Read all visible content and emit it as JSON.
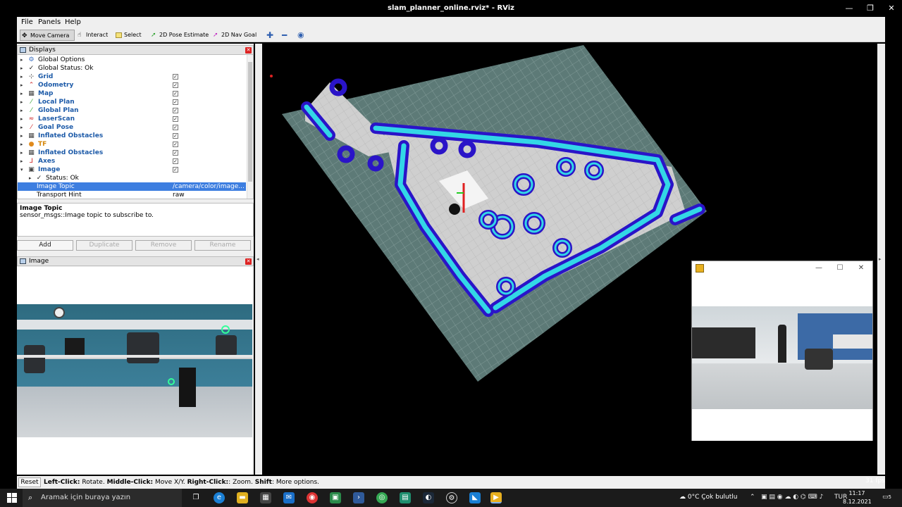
{
  "window": {
    "title": "slam_planner_online.rviz* - RViz"
  },
  "menu": {
    "file": "File",
    "panels": "Panels",
    "help": "Help"
  },
  "toolbar": {
    "move_camera": "Move Camera",
    "interact": "Interact",
    "select": "Select",
    "pose_estimate": "2D Pose Estimate",
    "nav_goal": "2D Nav Goal"
  },
  "displays_panel": {
    "title": "Displays",
    "items": [
      {
        "label": "Global Options",
        "type": "opt"
      },
      {
        "label": "Global Status: Ok",
        "type": "opt"
      },
      {
        "label": "Grid",
        "type": "disp",
        "checked": true
      },
      {
        "label": "Odometry",
        "type": "disp",
        "checked": true
      },
      {
        "label": "Map",
        "type": "disp",
        "checked": true
      },
      {
        "label": "Local Plan",
        "type": "disp",
        "checked": true
      },
      {
        "label": "Global Plan",
        "type": "disp",
        "checked": true
      },
      {
        "label": "LaserScan",
        "type": "disp",
        "checked": true
      },
      {
        "label": "Goal Pose",
        "type": "disp",
        "checked": true
      },
      {
        "label": "Inflated Obstacles",
        "type": "disp",
        "checked": true
      },
      {
        "label": "TF",
        "type": "disp",
        "checked": true
      },
      {
        "label": "Inflated Obstacles",
        "type": "disp",
        "checked": true
      },
      {
        "label": "Axes",
        "type": "disp",
        "checked": true
      },
      {
        "label": "Image",
        "type": "disp",
        "checked": true
      },
      {
        "label": "Status: Ok",
        "type": "sub"
      },
      {
        "label": "Image Topic",
        "type": "prop",
        "value": "/camera/color/image...",
        "selected": true
      },
      {
        "label": "Transport Hint",
        "type": "prop",
        "value": "raw"
      }
    ],
    "desc_title": "Image Topic",
    "desc_text": "sensor_msgs::Image topic to subscribe to.",
    "buttons": {
      "add": "Add",
      "duplicate": "Duplicate",
      "remove": "Remove",
      "rename": "Rename"
    }
  },
  "image_panel": {
    "title": "Image"
  },
  "statusbar": {
    "reset": "Reset",
    "left_click": "Left-Click:",
    "left_action": " Rotate. ",
    "middle_click": "Middle-Click:",
    "middle_action": " Move X/Y. ",
    "right_click": "Right-Click:",
    "right_action": ": Zoom. ",
    "shift": "Shift",
    "shift_action": ": More options.",
    "fps": "31 fps"
  },
  "taskbar": {
    "search_placeholder": "Aramak için buraya yazın",
    "weather": "0°C  Çok bulutlu",
    "lang": "TUR",
    "time": "11:17",
    "date": "8.12.2021",
    "notifications": "5"
  },
  "colors": {
    "grid_fill": "#5d7a77",
    "free_space": "#cfcfcf",
    "inflation": "#33d7e6",
    "obstacle": "#2a14c8",
    "selection": "#3d7ee0"
  }
}
